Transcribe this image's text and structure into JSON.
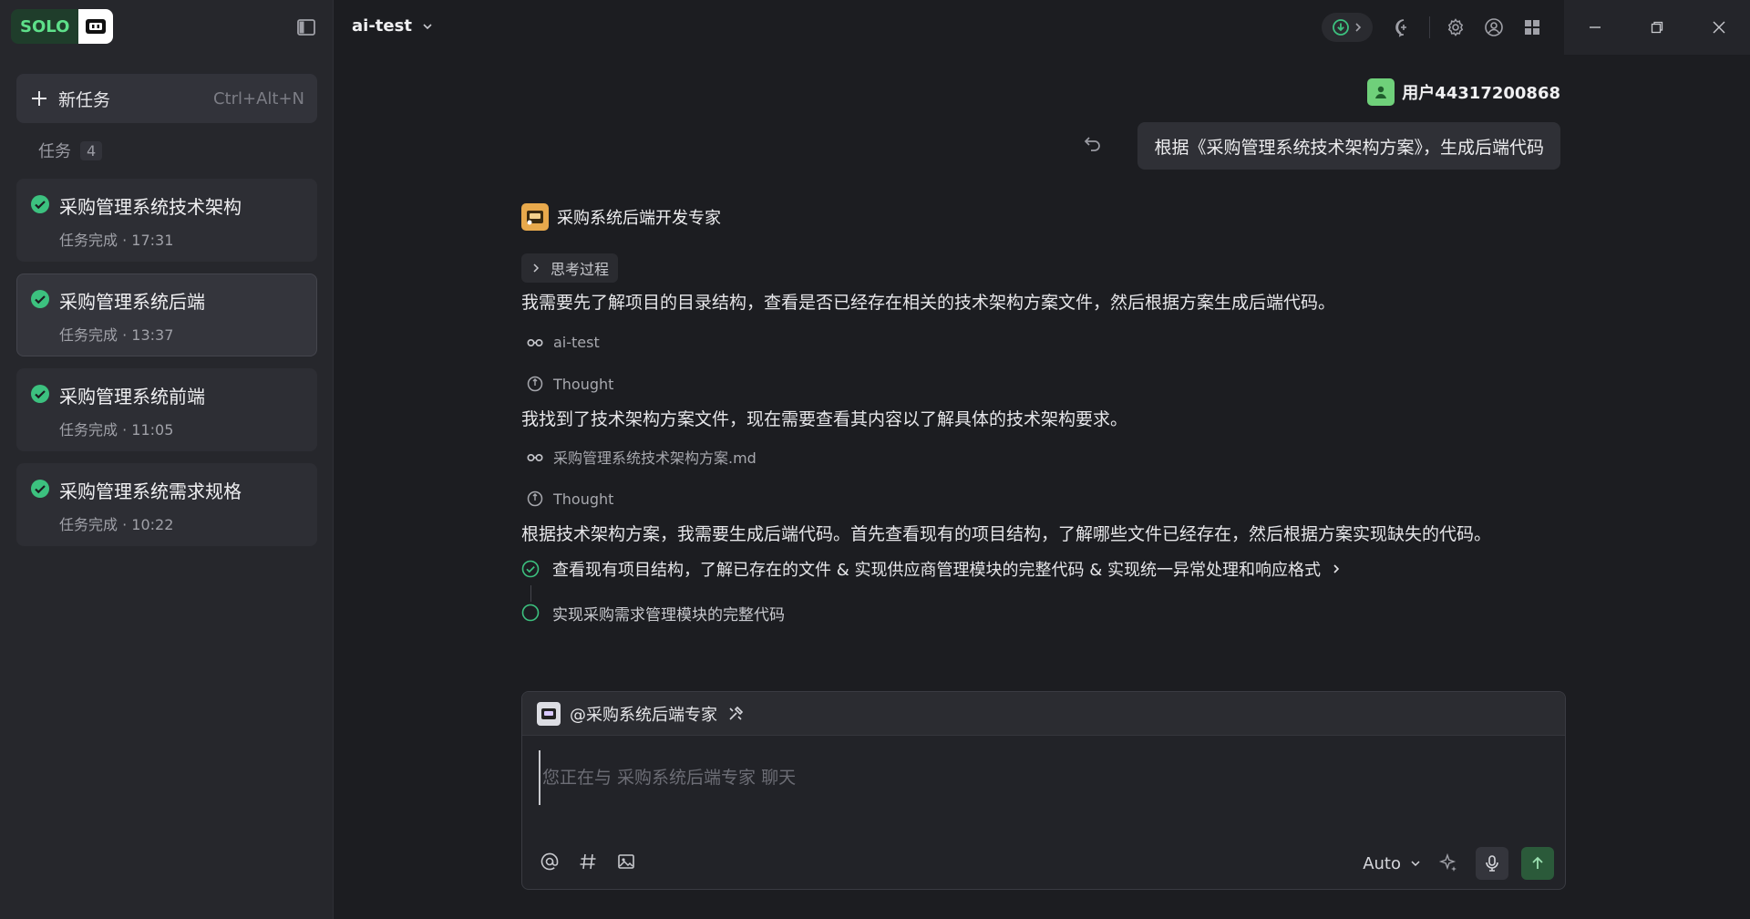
{
  "app": {
    "logo_text": "SOLO",
    "project_name": "ai-test"
  },
  "sidebar": {
    "new_task_label": "新任务",
    "new_task_shortcut": "Ctrl+Alt+N",
    "tasks_label": "任务",
    "tasks_count": "4",
    "tasks": [
      {
        "title": "采购管理系统技术架构",
        "meta": "任务完成 · 17:31",
        "active": false
      },
      {
        "title": "采购管理系统后端",
        "meta": "任务完成 · 13:37",
        "active": true
      },
      {
        "title": "采购管理系统前端",
        "meta": "任务完成 · 11:05",
        "active": false
      },
      {
        "title": "采购管理系统需求规格",
        "meta": "任务完成 · 10:22",
        "active": false
      }
    ]
  },
  "user": {
    "name": "用户44317200868",
    "message": "根据《采购管理系统技术架构方案》，生成后端代码"
  },
  "agent": {
    "name": "采购系统后端开发专家",
    "thinking_label": "思考过程",
    "para1": "我需要先了解项目的目录结构，查看是否已经存在相关的技术架构方案文件，然后根据方案生成后端代码。",
    "tool1": "ai-test",
    "thought1": "Thought",
    "para2": "我找到了技术架构方案文件，现在需要查看其内容以了解具体的技术架构要求。",
    "tool2": "采购管理系统技术架构方案.md",
    "thought2": "Thought",
    "para3": "根据技术架构方案，我需要生成后端代码。首先查看现有的项目结构，了解哪些文件已经存在，然后根据方案实现缺失的代码。",
    "todo1": "查看现有项目结构，了解已存在的文件 & 实现供应商管理模块的完整代码 & 实现统一异常处理和响应格式",
    "todo2": "实现采购需求管理模块的完整代码"
  },
  "composer": {
    "mention": "@采购系统后端专家",
    "placeholder": "您正在与 采购系统后端专家 聊天",
    "model": "Auto"
  },
  "colors": {
    "accent_green": "#3cc17f",
    "background": "#1c1d21",
    "sidebar": "#26272c"
  }
}
